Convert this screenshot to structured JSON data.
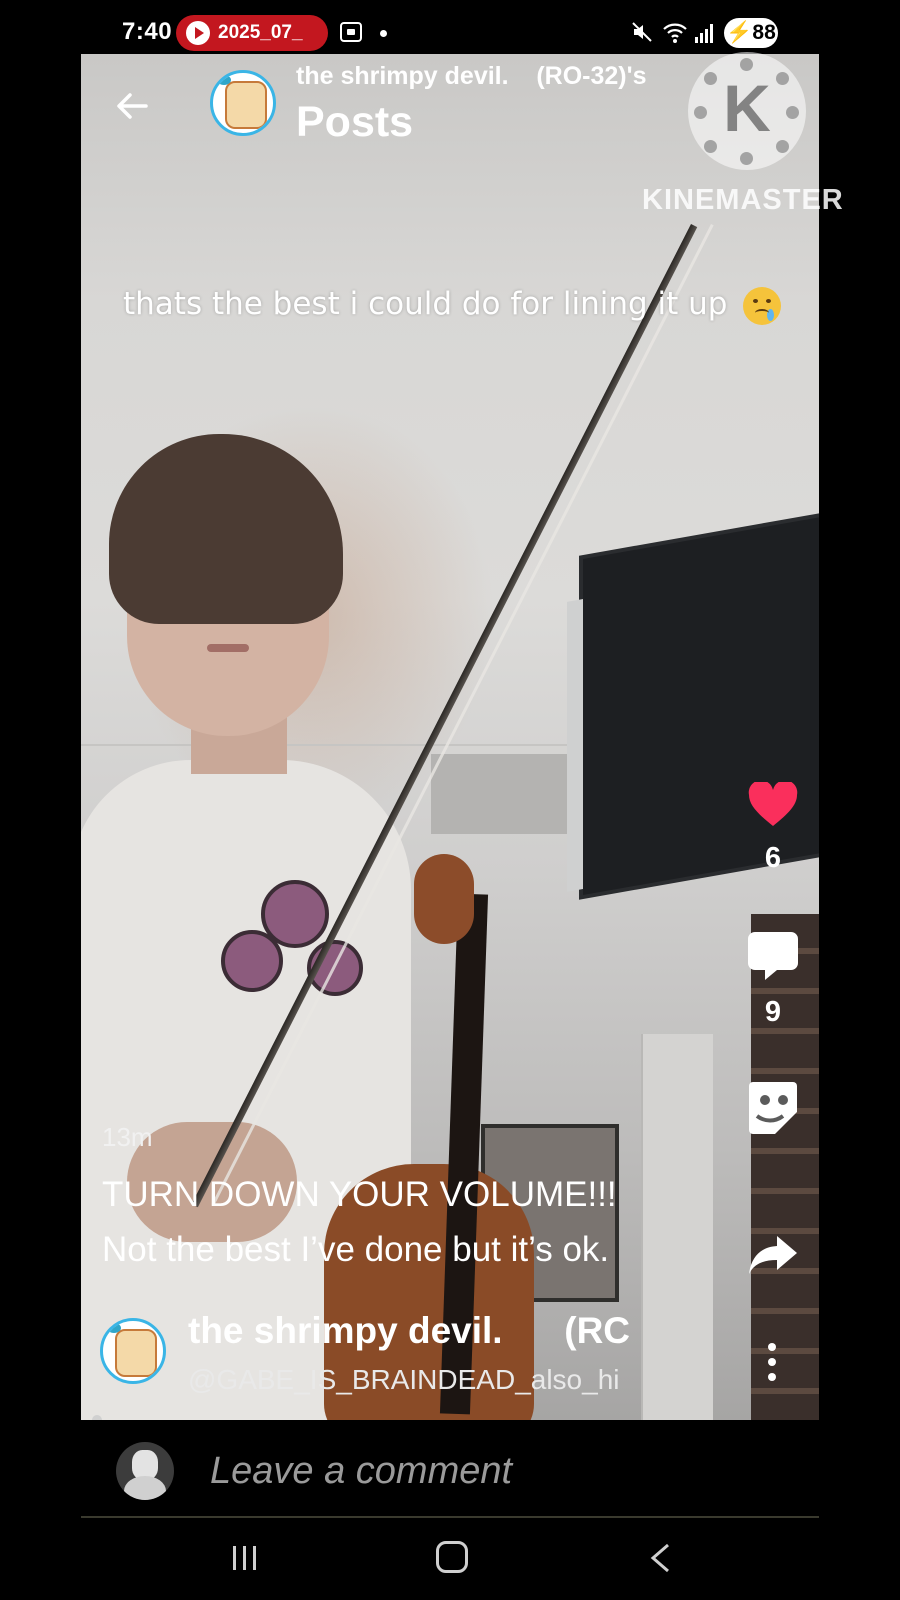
{
  "status_bar": {
    "time": "7:40",
    "recording_label": "2025_07_",
    "battery": "88"
  },
  "header": {
    "subtitle": "the shrimpy devil.    (RO-32)'s",
    "title": "Posts"
  },
  "watermark": {
    "logo_letter": "K",
    "label": "KINEMASTER"
  },
  "video_caption": "thats the best i could do for lining it up",
  "post": {
    "time_ago": "13m",
    "title": "TURN DOWN YOUR VOLUME!!!",
    "body": "Not the best I’ve done but it’s ok.",
    "author_name": "the shrimpy devil.      (RC",
    "author_handle": "@GABE_IS_BRAINDEAD_also_hi"
  },
  "actions": {
    "likes": "6",
    "comments": "9"
  },
  "comment_bar": {
    "placeholder": "Leave a comment"
  },
  "colors": {
    "heart": "#fa2f5c",
    "recording_pill": "#c3171f",
    "avatar_ring": "#3ab5e6"
  },
  "icons": [
    "back-arrow-icon",
    "heart-icon",
    "comment-icon",
    "sticker-icon",
    "share-icon",
    "more-vertical-icon",
    "recents-icon",
    "home-icon",
    "back-icon"
  ]
}
